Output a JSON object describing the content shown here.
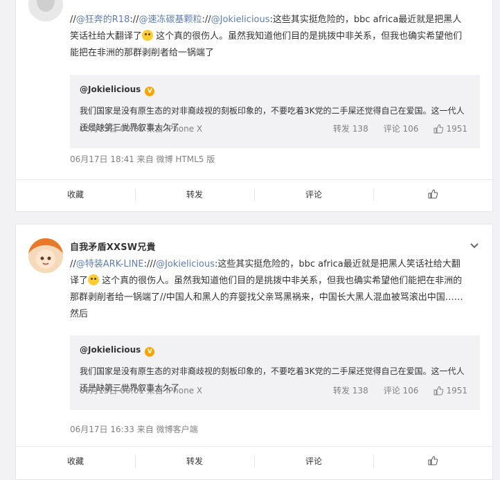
{
  "posts": [
    {
      "content_prefix": "//",
      "mention1": "@狂奔的R18",
      "sep1": "://",
      "mention2": "@速冻碳基颗粒",
      "sep2": "://",
      "mention3": "@Jokielicious",
      "body1": ":这些其实挺危险的，bbc africa最近就是把黑人笑话社给大翻译了",
      "body2": " 这个真的很伤人。虽然我知道他们目的是挑拨中非关系，但我也确实希望他们能把在非洲的那群剥削者给一锅端了",
      "quote": {
        "user": "@Jokielicious",
        "badge": "V",
        "text": "我们国家是没有原生态的对非裔歧视的刻板印象的，不要吃着3K党的二手屎还觉得自己在爱国。这一代人还是缺第三世界叙事太久了",
        "meta": "06月15日 00:01 来自 iPhone X",
        "reposts": "转发 138",
        "comments": "评论 106",
        "likes": "1951"
      },
      "meta": "06月17日 18:41  来自 微博 HTML5 版"
    },
    {
      "username": "自我矛盾XXSW兄貴",
      "content_prefix": "//",
      "mention1": "@特装ARK-LINE",
      "sep1": ":///",
      "mention2": "@Jokielicious",
      "body1": ":这些其实挺危险的，bbc africa最近就是把黑人笑话社给大翻译了",
      "body2": " 这个真的很伤人。虽然我知道他们目的是挑拨中非关系，但我也确实希望他们能把在非洲的那群剥削者给一锅端了//中国人和黑人的弃婴找父亲骂黑祸来，中国长大黑人混血被骂滚出中国……然后",
      "quote": {
        "user": "@Jokielicious",
        "badge": "V",
        "text": "我们国家是没有原生态的对非裔歧视的刻板印象的，不要吃着3K党的二手屎还觉得自己在爱国。这一代人还是缺第三世界叙事太久了",
        "meta": "06月15日 00:01 来自 iPhone X",
        "reposts": "转发 138",
        "comments": "评论 106",
        "likes": "1951"
      },
      "meta": "06月17日 16:33  来自 微博客户端"
    }
  ],
  "actions": {
    "favorite": "收藏",
    "repost": "转发",
    "comment": "评论"
  }
}
